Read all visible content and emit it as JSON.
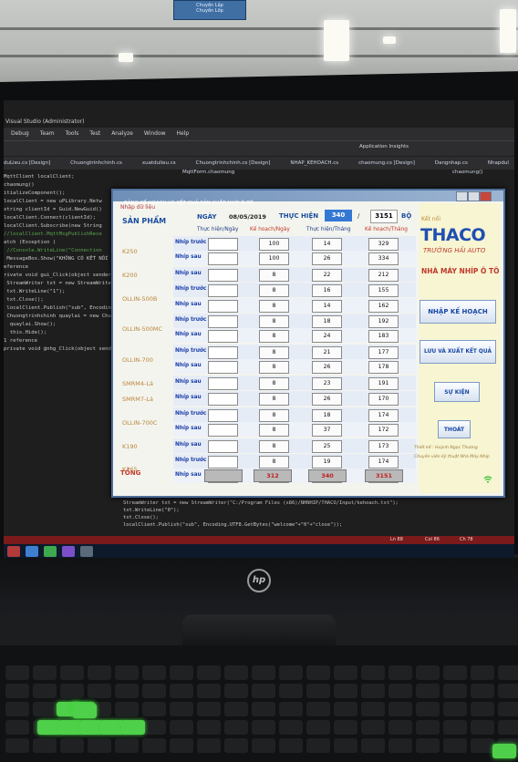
{
  "sign": {
    "line1": "Chuyền Lắp",
    "line2": "Chuyền Lốp"
  },
  "vs": {
    "menu": [
      "Debug",
      "Team",
      "Tools",
      "Test",
      "Analyze",
      "Window",
      "Help"
    ],
    "title_fragment": "Visual Studio (Administrator)",
    "insights": "Application Insights",
    "tabs": [
      "duLieu.cs [Design]",
      "Chuongtrinhchinh.cs",
      "xuatdulieu.cs",
      "Chuongtrinhchinh.cs [Design]",
      "NHAP_KEHOACH.cs",
      "chaomung.cs [Design]",
      "Dangnhap.cs",
      "Nhapdul"
    ],
    "subtab": "MqttForm.chaomung",
    "subtab_right": "chaomung()",
    "code_lines": [
      "MqttClient localClient;",
      "",
      "",
      "chaomung()",
      "",
      "itializeComponent();",
      "",
      "",
      "",
      "",
      "localClient = new uPLibrary.Netw",
      "string clientId = Guid.NewGuid()",
      "localClient.Connect(clientId);",
      "",
      "localClient.Subscribe(new String",
      "",
      "",
      "//localClient.MqttMsgPublishRece",
      "",
      "",
      "atch (Exception )",
      "",
      " //Console.WriteLine(\"Connection",
      " MessageBox.Show(\"KHÔNG CÓ KẾT NỐI",
      "",
      "",
      "",
      "eference",
      "rivate void gui_Click(object sender, Eve",
      "",
      " StreamWriter txt = new StreamWriter(",
      " txt.WriteLine(\"1\");",
      " txt.Close();",
      " localClient.Publish(\"sub\", Encoding.",
      "",
      " Chuongtrinhchinh quaylai = new Chuon",
      "  quaylai.Show();",
      "  this.Hide();",
      "",
      "",
      "1 reference",
      "private void @nhg_Click(object sender, EventArgs e)"
    ],
    "code_bottom": [
      "{",
      "    StreamWriter txt = new StreamWriter(\"C:/Program Files (x86)/NHNHIP/THACO/Input/kehoach.txt\");",
      "    txt.WriteLine(\"0\");",
      "    txt.Close();",
      "    localClient.Publish(\"sub\", Encoding.UTF8.GetBytes(\"welcome\"+\"0\"+\"close\"));"
    ],
    "status": {
      "ln": "Ln 88",
      "col": "Col 86",
      "ch": "Ch 78"
    }
  },
  "form": {
    "title": "BẢNG KẾ HOẠCH VÀ KẾT QUẢ SẢN XUẤT NHÍP Ô TÔ",
    "nhap_du_lieu": "Nhập dữ liệu",
    "ngay_label": "NGÀY",
    "ngay_value": "08/05/2019",
    "thuc_hien_label": "THỰC HIỆN",
    "thuc_hien_value": "340",
    "slash": "/",
    "total_value": "3151",
    "bo": "BỘ",
    "san_pham": "SẢN PHẨM",
    "col_headers": [
      "Thực hiện/Ngày",
      "Kế hoạch/Ngày",
      "Thực hiện/Tháng",
      "Kế hoạch/Tháng"
    ],
    "ket_noi": "Kết nối",
    "brand": "THACO",
    "brand_sub": "TRƯỜNG HẢI AUTO",
    "factory": "NHÀ MÁY NHÍP Ô TÔ",
    "buttons": {
      "nhap_ke_hoach": "NHẬP KẾ HOẠCH",
      "luu_xuat": "LƯU VÀ XUẤT KẾT QUẢ",
      "su_kien": "SỰ KIỆN",
      "thoat": "THOÁT"
    },
    "credit1": "Thiết kế : Huỳnh Ngọc Thương",
    "credit2": "Chuyên viên kỹ thuật Nhà Máy Nhíp",
    "products": [
      {
        "name": "K250",
        "rows": [
          {
            "sub": "Nhíp trước",
            "kh_ngay": "100",
            "th_thang": "14",
            "kh_thang": "329"
          },
          {
            "sub": "Nhíp sau",
            "kh_ngay": "100",
            "th_thang": "26",
            "kh_thang": "334"
          }
        ]
      },
      {
        "name": "K200",
        "rows": [
          {
            "sub": "Nhíp sau",
            "kh_ngay": "8",
            "th_thang": "22",
            "kh_thang": "212"
          }
        ]
      },
      {
        "name": "OLLIN-500B",
        "rows": [
          {
            "sub": "Nhíp trước",
            "kh_ngay": "8",
            "th_thang": "16",
            "kh_thang": "155"
          },
          {
            "sub": "Nhíp sau",
            "kh_ngay": "8",
            "th_thang": "14",
            "kh_thang": "162"
          }
        ]
      },
      {
        "name": "OLLIN-500MC",
        "rows": [
          {
            "sub": "Nhíp trước",
            "kh_ngay": "8",
            "th_thang": "18",
            "kh_thang": "192"
          },
          {
            "sub": "Nhíp sau",
            "kh_ngay": "8",
            "th_thang": "24",
            "kh_thang": "183"
          }
        ]
      },
      {
        "name": "OLLIN-700",
        "rows": [
          {
            "sub": "Nhíp trước",
            "kh_ngay": "8",
            "th_thang": "21",
            "kh_thang": "177"
          },
          {
            "sub": "Nhíp sau",
            "kh_ngay": "8",
            "th_thang": "26",
            "kh_thang": "178"
          }
        ]
      },
      {
        "name": "SMRM4-Lá",
        "rows": [
          {
            "sub": "Nhíp sau",
            "kh_ngay": "8",
            "th_thang": "23",
            "kh_thang": "191"
          }
        ]
      },
      {
        "name": "SMRM7-Lá",
        "rows": [
          {
            "sub": "Nhíp sau",
            "kh_ngay": "8",
            "th_thang": "26",
            "kh_thang": "170"
          }
        ]
      },
      {
        "name": "OLLIN-700C",
        "rows": [
          {
            "sub": "Nhíp trước",
            "kh_ngay": "8",
            "th_thang": "18",
            "kh_thang": "174"
          },
          {
            "sub": "Nhíp sau",
            "kh_ngay": "8",
            "th_thang": "37",
            "kh_thang": "172"
          }
        ]
      },
      {
        "name": "K190",
        "rows": [
          {
            "sub": "Nhíp sau",
            "kh_ngay": "8",
            "th_thang": "25",
            "kh_thang": "173"
          }
        ]
      },
      {
        "name": "K165",
        "rows": [
          {
            "sub": "Nhíp trước",
            "kh_ngay": "8",
            "th_thang": "19",
            "kh_thang": "174"
          },
          {
            "sub": "Nhíp sau",
            "kh_ngay": "8",
            "th_thang": "19",
            "kh_thang": "175"
          }
        ]
      }
    ],
    "tong_label": "TỔNG",
    "tong_values": [
      "",
      "312",
      "340",
      "3151"
    ]
  },
  "monitor_brand": "hp"
}
